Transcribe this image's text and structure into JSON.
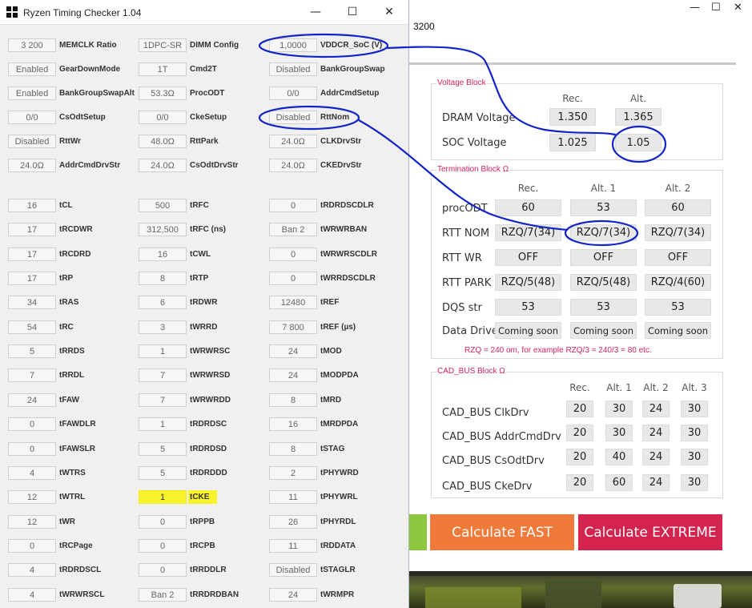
{
  "window": {
    "title": "Ryzen Timing Checker 1.04",
    "minimize_glyph": "—",
    "maximize_glyph": "☐",
    "close_glyph": "✕",
    "app_icon": "grid-app-icon"
  },
  "bg_window": {
    "minimize_glyph": "—",
    "maximize_glyph": "☐",
    "close_glyph": "✕",
    "memory_speed": "3200"
  },
  "timings": [
    {
      "value": "3 200",
      "label": "MEMCLK Ratio"
    },
    {
      "value": "1DPC-SR",
      "label": "DIMM Config"
    },
    {
      "value": "1,0000",
      "label": "VDDCR_SoC (V)"
    },
    {
      "value": "Enabled",
      "label": "GearDownMode"
    },
    {
      "value": "1T",
      "label": "Cmd2T"
    },
    {
      "value": "Disabled",
      "label": "BankGroupSwap"
    },
    {
      "value": "Enabled",
      "label": "BankGroupSwapAlt"
    },
    {
      "value": "53.3Ω",
      "label": "ProcODT"
    },
    {
      "value": "0/0",
      "label": "AddrCmdSetup"
    },
    {
      "value": "0/0",
      "label": "CsOdtSetup"
    },
    {
      "value": "0/0",
      "label": "CkeSetup"
    },
    {
      "value": "Disabled",
      "label": "RttNom"
    },
    {
      "value": "Disabled",
      "label": "RttWr"
    },
    {
      "value": "48.0Ω",
      "label": "RttPark"
    },
    {
      "value": "24.0Ω",
      "label": "CLKDrvStr"
    },
    {
      "value": "24.0Ω",
      "label": "AddrCmdDrvStr"
    },
    {
      "value": "24.0Ω",
      "label": "CsOdtDrvStr"
    },
    {
      "value": "24.0Ω",
      "label": "CKEDrvStr"
    },
    {
      "value": "16",
      "label": "tCL"
    },
    {
      "value": "500",
      "label": "tRFC"
    },
    {
      "value": "0",
      "label": "tRDRDSCDLR"
    },
    {
      "value": "17",
      "label": "tRCDWR"
    },
    {
      "value": "312,500",
      "label": "tRFC (ns)"
    },
    {
      "value": "Ban 2",
      "label": "tWRWRBAN"
    },
    {
      "value": "17",
      "label": "tRCDRD"
    },
    {
      "value": "16",
      "label": "tCWL"
    },
    {
      "value": "0",
      "label": "tWRWRSCDLR"
    },
    {
      "value": "17",
      "label": "tRP"
    },
    {
      "value": "8",
      "label": "tRTP"
    },
    {
      "value": "0",
      "label": "tWRRDSCDLR"
    },
    {
      "value": "34",
      "label": "tRAS"
    },
    {
      "value": "6",
      "label": "tRDWR"
    },
    {
      "value": "12480",
      "label": "tREF"
    },
    {
      "value": "54",
      "label": "tRC"
    },
    {
      "value": "3",
      "label": "tWRRD"
    },
    {
      "value": "7 800",
      "label": "tREF (µs)"
    },
    {
      "value": "5",
      "label": "tRRDS"
    },
    {
      "value": "1",
      "label": "tWRWRSC"
    },
    {
      "value": "24",
      "label": "tMOD"
    },
    {
      "value": "7",
      "label": "tRRDL"
    },
    {
      "value": "7",
      "label": "tWRWRSD"
    },
    {
      "value": "24",
      "label": "tMODPDA"
    },
    {
      "value": "24",
      "label": "tFAW"
    },
    {
      "value": "7",
      "label": "tWRWRDD"
    },
    {
      "value": "8",
      "label": "tMRD"
    },
    {
      "value": "0",
      "label": "tFAWDLR"
    },
    {
      "value": "1",
      "label": "tRDRDSC"
    },
    {
      "value": "16",
      "label": "tMRDPDA"
    },
    {
      "value": "0",
      "label": "tFAWSLR"
    },
    {
      "value": "5",
      "label": "tRDRDSD"
    },
    {
      "value": "8",
      "label": "tSTAG"
    },
    {
      "value": "4",
      "label": "tWTRS"
    },
    {
      "value": "5",
      "label": "tRDRDDD"
    },
    {
      "value": "2",
      "label": "tPHYWRD"
    },
    {
      "value": "12",
      "label": "tWTRL"
    },
    {
      "value": "1",
      "label": "tCKE",
      "highlight": true
    },
    {
      "value": "11",
      "label": "tPHYWRL"
    },
    {
      "value": "12",
      "label": "tWR"
    },
    {
      "value": "0",
      "label": "tRPPB"
    },
    {
      "value": "26",
      "label": "tPHYRDL"
    },
    {
      "value": "0",
      "label": "tRCPage"
    },
    {
      "value": "0",
      "label": "tRCPB"
    },
    {
      "value": "11",
      "label": "tRDDATA"
    },
    {
      "value": "4",
      "label": "tRDRDSCL"
    },
    {
      "value": "0",
      "label": "tRRDDLR"
    },
    {
      "value": "Disabled",
      "label": "tSTAGLR"
    },
    {
      "value": "4",
      "label": "tWRWRSCL"
    },
    {
      "value": "Ban 2",
      "label": "tRRDRDBAN"
    },
    {
      "value": "24",
      "label": "tWRMPR"
    }
  ],
  "voltage_block": {
    "title": "Voltage Block",
    "headers": [
      "Rec.",
      "Alt."
    ],
    "rows": [
      {
        "label": "DRAM Voltage",
        "values": [
          "1.350",
          "1.365"
        ]
      },
      {
        "label": "SOC Voltage",
        "values": [
          "1.025",
          "1.05"
        ]
      }
    ]
  },
  "termination_block": {
    "title": "Termination Block Ω",
    "headers": [
      "Rec.",
      "Alt. 1",
      "Alt. 2"
    ],
    "rows": [
      {
        "label": "procODT",
        "values": [
          "60",
          "53",
          "60"
        ]
      },
      {
        "label": "RTT NOM",
        "values": [
          "RZQ/7(34)",
          "RZQ/7(34)",
          "RZQ/7(34)"
        ]
      },
      {
        "label": "RTT WR",
        "values": [
          "OFF",
          "OFF",
          "OFF"
        ]
      },
      {
        "label": "RTT PARK",
        "values": [
          "RZQ/5(48)",
          "RZQ/5(48)",
          "RZQ/4(60)"
        ]
      },
      {
        "label": "DQS str",
        "values": [
          "53",
          "53",
          "53"
        ]
      },
      {
        "label": "Data Drive",
        "values": [
          "Coming soon",
          "Coming soon",
          "Coming soon"
        ]
      }
    ],
    "note": "RZQ = 240 om, for example RZQ/3 = 240/3 = 80 etc."
  },
  "cad_bus_block": {
    "title": "CAD_BUS Block Ω",
    "headers": [
      "Rec.",
      "Alt. 1",
      "Alt. 2",
      "Alt. 3"
    ],
    "rows": [
      {
        "label": "CAD_BUS ClkDrv",
        "values": [
          "20",
          "30",
          "24",
          "30"
        ]
      },
      {
        "label": "CAD_BUS AddrCmdDrv",
        "values": [
          "20",
          "30",
          "24",
          "30"
        ]
      },
      {
        "label": "CAD_BUS CsOdtDrv",
        "values": [
          "20",
          "40",
          "24",
          "30"
        ]
      },
      {
        "label": "CAD_BUS CkeDrv",
        "values": [
          "20",
          "60",
          "24",
          "30"
        ]
      }
    ]
  },
  "buttons": {
    "fast": "Calculate FAST",
    "extreme": "Calculate EXTREME"
  },
  "colors": {
    "accent_red": "#d4235a",
    "button_fast": "#f07a3a",
    "button_extreme": "#d4234f",
    "button_safe": "#8dc63f",
    "highlight": "#f8f32a",
    "annotation_ink": "#1224c8"
  }
}
